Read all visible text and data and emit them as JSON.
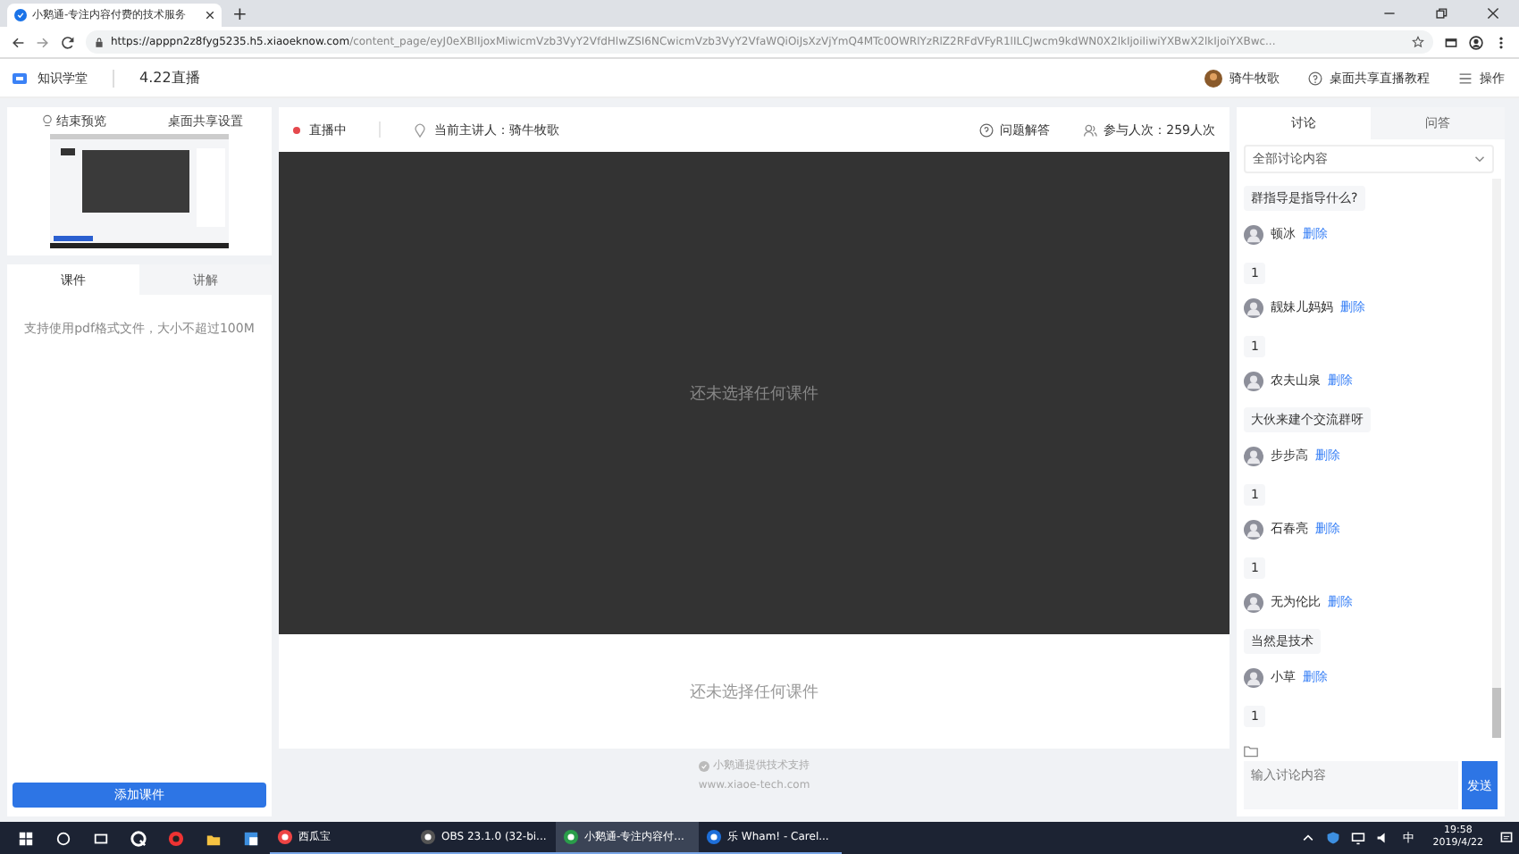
{
  "browser": {
    "tab_title": "小鹅通-专注内容付费的技术服务",
    "new_tab": "+",
    "url_host": "https://apppn2z8fyg5235.h5.xiaoeknow.com",
    "url_path": "/content_page/eyJ0eXBlIjoxMiwicmVzb3VyY2VfdHlwZSI6NCwicmVzb3VyY2VfaWQiOiJsXzVjYmQ4MTc0OWRlYzRlZ2RFdVFyR1lILCJwcm9kdWN0X2lkIjoiIiwiYXBwX2lkIjoiYXBwc..."
  },
  "header": {
    "brand": "知识学堂",
    "title": "4.22直播",
    "user": "骑牛牧歌",
    "tutorial": "桌面共享直播教程",
    "menu": "操作"
  },
  "left": {
    "top_buttons": [
      {
        "label": "结束预览",
        "kind": "icon"
      },
      {
        "label": "桌面共享设置",
        "kind": "plain"
      }
    ],
    "tabs": [
      {
        "label": "课件",
        "selected": true
      },
      {
        "label": "讲解",
        "selected": false
      }
    ],
    "hint": "支持使用pdf格式文件，大小不超过100M",
    "add_button": "添加课件"
  },
  "center": {
    "status": "直播中",
    "live": true,
    "speaker": "当前主讲人：骑牛牧歌",
    "qa": "问题解答",
    "participants": "参与人次：259人次",
    "empty_video": "还未选择任何课件",
    "empty_lower": "还未选择任何课件",
    "credit": "小鹅通提供技术支持",
    "credit_url": "www.xiaoe-tech.com"
  },
  "chat": {
    "tabs": [
      {
        "label": "讨论",
        "selected": true
      },
      {
        "label": "问答",
        "selected": false
      }
    ],
    "filter": "全部讨论内容",
    "messages": [
      {
        "text": "群指导是指导什么?",
        "partial": true
      },
      {
        "name": "顿冰",
        "action": "删除",
        "text": "1",
        "partial": false
      },
      {
        "name": "靓妹儿妈妈",
        "action": "删除",
        "text": "1",
        "partial": false
      },
      {
        "name": "农夫山泉",
        "action": "删除",
        "text": "大伙来建个交流群呀",
        "partial": false
      },
      {
        "name": "步步高",
        "action": "删除",
        "text": "1",
        "partial": false
      },
      {
        "name": "石春亮",
        "action": "删除",
        "text": "1",
        "partial": false
      },
      {
        "name": "无为伦比",
        "action": "删除",
        "text": "当然是技术",
        "partial": false
      },
      {
        "name": "小草",
        "action": "删除",
        "text": "1",
        "partial": false
      }
    ],
    "placeholder": "输入讨论内容",
    "send": "发送"
  },
  "taskbar": {
    "items": [
      {
        "label": "西瓜宝",
        "active": false
      },
      {
        "label": "OBS 23.1.0 (32-bi...",
        "active": false
      },
      {
        "label": "小鹅通-专注内容付...",
        "active": true
      },
      {
        "label": "乐 Wham! - Carel...",
        "active": false
      }
    ],
    "ime": "中",
    "time": "19:58",
    "date": "2019/4/22"
  }
}
